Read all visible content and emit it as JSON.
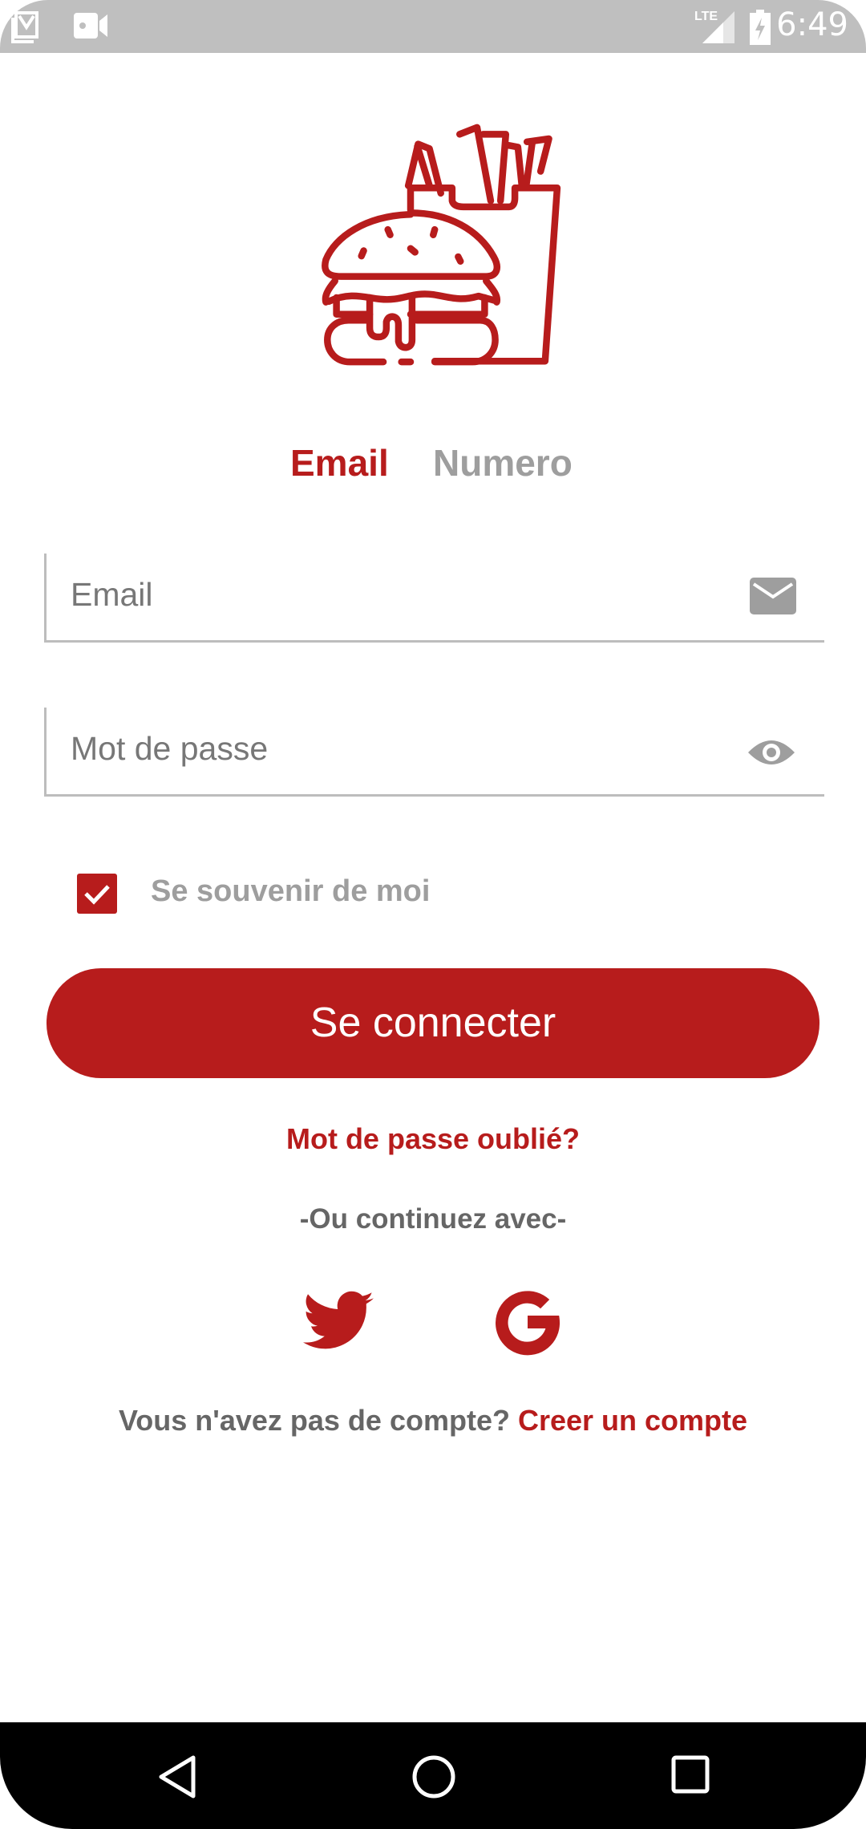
{
  "status_bar": {
    "time": "6:49",
    "network": "LTE",
    "icons": [
      "gmail-icon",
      "video-camera-icon",
      "lte-signal-icon",
      "battery-charging-icon"
    ]
  },
  "logo": {
    "icon": "burger-fries-icon",
    "color": "#b71c1c"
  },
  "tabs": [
    {
      "label": "Email",
      "active": true
    },
    {
      "label": "Numero",
      "active": false
    }
  ],
  "form": {
    "email": {
      "placeholder": "Email",
      "value": "",
      "icon": "mail-icon"
    },
    "password": {
      "placeholder": "Mot de passe",
      "value": "",
      "icon": "eye-icon"
    },
    "remember": {
      "label": "Se souvenir de moi",
      "checked": true
    }
  },
  "login_button": "Se connecter",
  "forgot_password": "Mot de passe oublié?",
  "divider_text": "-Ou continuez avec-",
  "social": [
    "twitter-icon",
    "google-icon"
  ],
  "signup": {
    "prompt": "Vous n'avez pas de compte?",
    "link": "Creer un compte"
  },
  "colors": {
    "accent": "#b71c1c",
    "muted": "#9e9e9e"
  }
}
